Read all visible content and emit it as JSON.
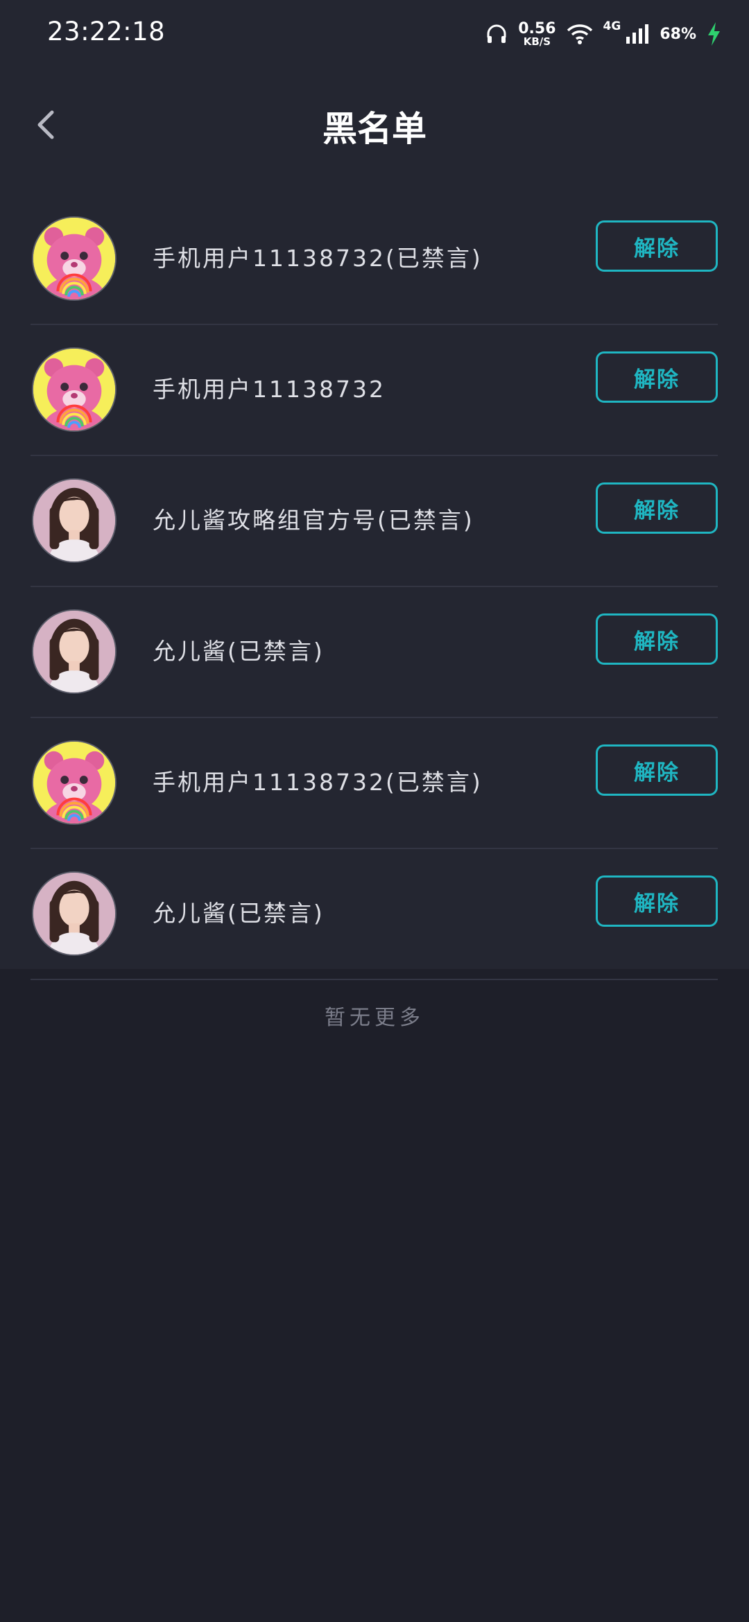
{
  "status_bar": {
    "time": "23:22:18",
    "net_speed": "0.56",
    "net_unit": "KB/S",
    "network_type": "4G",
    "battery": "68%"
  },
  "header": {
    "title": "黑名单"
  },
  "blacklist": [
    {
      "name": "手机用户11138732(已禁言)",
      "avatar": "bear-avatar",
      "action": "解除"
    },
    {
      "name": "手机用户11138732",
      "avatar": "bear-avatar",
      "action": "解除"
    },
    {
      "name": "允儿酱攻略组官方号(已禁言)",
      "avatar": "girl-avatar",
      "action": "解除"
    },
    {
      "name": "允儿酱(已禁言)",
      "avatar": "girl-avatar",
      "action": "解除"
    },
    {
      "name": "手机用户11138732(已禁言)",
      "avatar": "bear-avatar",
      "action": "解除"
    },
    {
      "name": "允儿酱(已禁言)",
      "avatar": "girl-avatar",
      "action": "解除"
    }
  ],
  "footer": {
    "no_more": "暂无更多"
  },
  "colors": {
    "accent": "#1fb6c2",
    "background": "#1e1f29",
    "panel": "#242631"
  }
}
